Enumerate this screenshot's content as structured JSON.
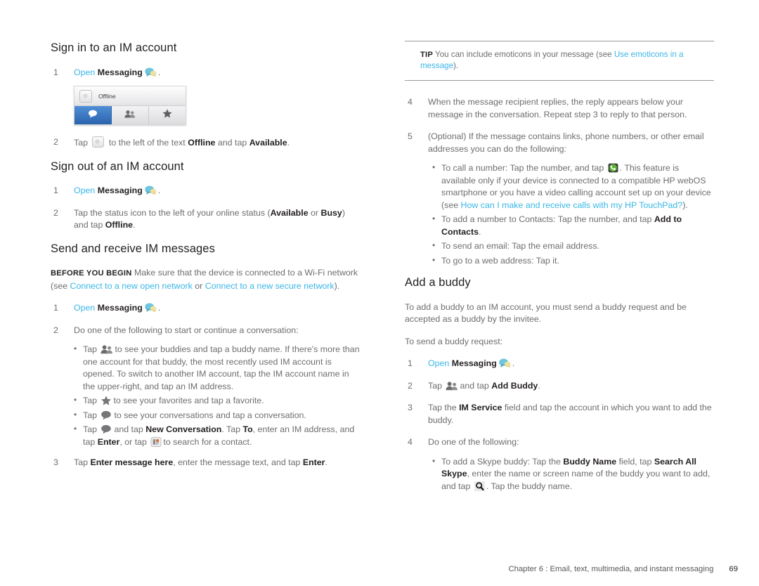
{
  "document": {
    "footer_text": "Chapter 6 :  Email, text, multimedia, and instant messaging",
    "page_number": "69"
  },
  "colors": {
    "link": "#39b7e5",
    "body_text": "#6d6e71",
    "heading": "#231f20",
    "rule": "#9a9a9d",
    "tab_active": "#2a63ad",
    "call_icon_green": "#4cae2a"
  },
  "left_column": {
    "section_sign_in": {
      "heading": "Sign in to an IM account",
      "step1": {
        "num": "1",
        "link": "Open",
        "bold": "Messaging",
        "icon": "messaging-icon",
        "period": "."
      },
      "figure": {
        "status_label": "Offline",
        "status_button_icon": "status-dot-button-icon",
        "tabs": [
          {
            "icon": "conversations-bubble-icon",
            "active": true
          },
          {
            "icon": "buddies-people-icon",
            "active": false
          },
          {
            "icon": "favorites-star-icon",
            "active": false
          }
        ]
      },
      "step2": {
        "num": "2",
        "pre": "Tap",
        "icon": "status-dot-button-icon",
        "mid": "to the left of the text",
        "bold1": "Offline",
        "mid2": "and tap",
        "bold2": "Available",
        "period": "."
      }
    },
    "section_sign_out": {
      "heading": "Sign out of an IM account",
      "step1": {
        "num": "1",
        "link": "Open",
        "bold": "Messaging",
        "icon": "messaging-icon",
        "period": "."
      },
      "step2": {
        "num": "2",
        "pre": "Tap the status icon to the left of your online status (",
        "bold1": "Available",
        "mid": " or ",
        "bold2": "Busy",
        "post": ") and tap ",
        "bold3": "Offline",
        "period": "."
      }
    },
    "section_send_receive": {
      "heading": "Send and receive IM messages",
      "before_you_begin": {
        "label": "BEFORE YOU BEGIN",
        "text_pre": " Make sure that the device is connected to a Wi-Fi network (see ",
        "link1": "Connect to a new open network",
        "mid": " or ",
        "link2": "Connect to a new secure network",
        "post": ")."
      },
      "step1": {
        "num": "1",
        "link": "Open",
        "bold": "Messaging",
        "icon": "messaging-icon",
        "period": "."
      },
      "step2": {
        "num": "2",
        "text": "Do one of the following to start or continue a conversation:",
        "bullets": [
          {
            "pre": "Tap",
            "icon": "buddies-people-icon",
            "post": "to see your buddies and tap a buddy name. If there's more than one account for that buddy, the most recently used IM account is opened. To switch to another IM account, tap the IM account name in the upper-right, and tap an IM address."
          },
          {
            "pre": "Tap",
            "icon": "favorites-star-icon",
            "post": "to see your favorites and tap a favorite."
          },
          {
            "pre": "Tap",
            "icon": "conversations-bubble-icon",
            "post": "to see your conversations and tap a conversation."
          },
          {
            "pre": "Tap",
            "icon": "conversations-bubble-icon",
            "mid1": "and tap",
            "bold1": "New Conversation",
            "mid2": ". Tap",
            "bold2": "To",
            "mid3": ", enter an IM address, and tap",
            "bold3": "Enter",
            "mid4": ", or tap",
            "icon2": "contact-search-icon",
            "post": "to search for a contact."
          }
        ]
      },
      "step3": {
        "num": "3",
        "pre": "Tap",
        "bold1": "Enter message here",
        "mid": ", enter the message text, and tap",
        "bold2": "Enter",
        "period": "."
      }
    }
  },
  "right_column": {
    "tip": {
      "label": "TIP",
      "text_pre": " You can include emoticons in your message (see ",
      "link": "Use emoticons in a message",
      "post": ")."
    },
    "step4": {
      "num": "4",
      "text": "When the message recipient replies, the reply appears below your message in the conversation. Repeat step 3 to reply to that person."
    },
    "step5": {
      "num": "5",
      "text": "(Optional) If the message contains links, phone numbers, or other email addresses you can do the following:",
      "bullets": [
        {
          "pre": "To call a number: Tap the number, and tap",
          "icon": "call-phone-icon",
          "mid": ". This feature is available only if your device is connected to a compatible HP webOS smartphone or you have a video calling account set up on your device (see ",
          "link": "How can I make and receive calls with my HP TouchPad?",
          "post": ")."
        },
        {
          "pre": "To add a number to Contacts: Tap the number, and tap ",
          "bold": "Add to Contacts",
          "post": "."
        },
        {
          "text": "To send an email: Tap the email address."
        },
        {
          "text": "To go to a web address: Tap it."
        }
      ]
    },
    "section_add_buddy": {
      "heading": "Add a buddy",
      "intro": "To add a buddy to an IM account, you must send a buddy request and be accepted as a buddy by the invitee.",
      "subintro": "To send a buddy request:",
      "step1": {
        "num": "1",
        "link": "Open",
        "bold": "Messaging",
        "icon": "messaging-icon",
        "period": "."
      },
      "step2": {
        "num": "2",
        "pre": "Tap",
        "icon": "buddies-people-icon",
        "mid": "and tap",
        "bold": "Add Buddy",
        "period": "."
      },
      "step3": {
        "num": "3",
        "pre": "Tap the ",
        "bold": "IM Service",
        "post": " field and tap the account in which you want to add the buddy."
      },
      "step4": {
        "num": "4",
        "text": "Do one of the following:",
        "bullets": [
          {
            "pre": "To add a Skype buddy: Tap the ",
            "bold1": "Buddy Name",
            "mid1": " field, tap ",
            "bold2": "Search All Skype",
            "mid2": ", enter the name or screen name of the buddy you want to add, and tap",
            "icon": "search-magnifier-icon",
            "post": ". Tap the buddy name."
          }
        ]
      }
    }
  }
}
